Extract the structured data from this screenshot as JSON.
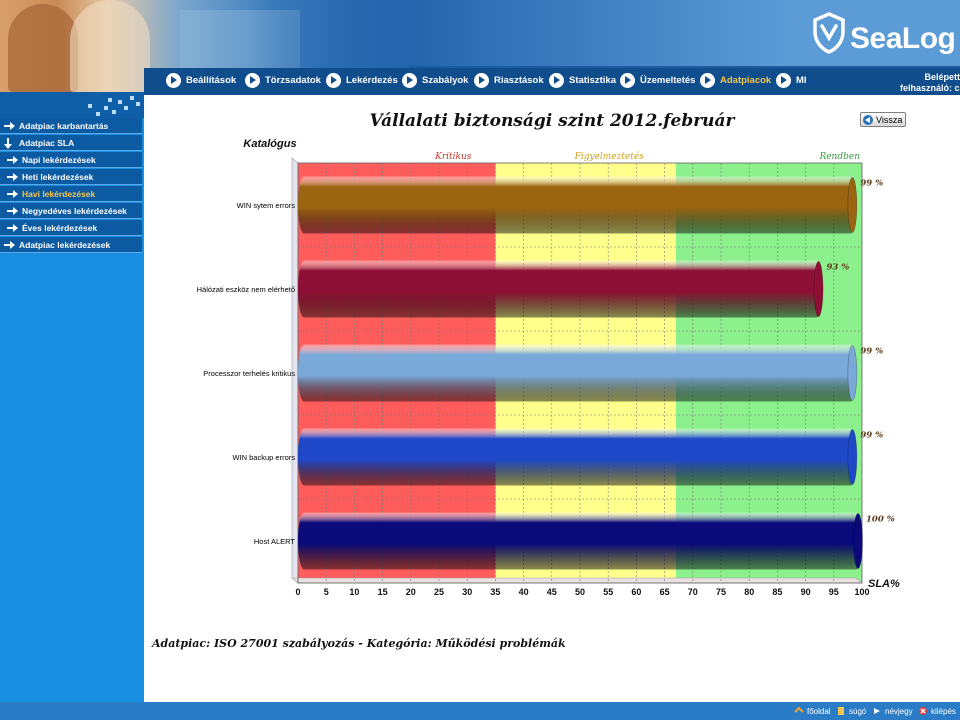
{
  "brand": {
    "logo_text": "SeaLog"
  },
  "nav": {
    "items": [
      {
        "label": "Beállítások"
      },
      {
        "label": "Törzsadatok"
      },
      {
        "label": "Lekérdezés"
      },
      {
        "label": "Szabályok"
      },
      {
        "label": "Riasztások"
      },
      {
        "label": "Statisztika"
      },
      {
        "label": "Üzemeltetés"
      },
      {
        "label": "Adatpiacok"
      },
      {
        "label": "MI"
      }
    ],
    "active_item": "Adatpiacok",
    "login_line1": "Belépett",
    "login_line2": "felhasználó: csizmar"
  },
  "sidebar": {
    "items": [
      {
        "label": "Adatpiac karbantartás"
      },
      {
        "label": "Adatpiac SLA"
      },
      {
        "label": "Napi lekérdezések"
      },
      {
        "label": "Heti lekérdezések"
      },
      {
        "label": "Havi lekérdezések"
      },
      {
        "label": "Negyedéves lekérdezések"
      },
      {
        "label": "Éves lekérdezések"
      },
      {
        "label": "Adatpiac lekérdezések"
      }
    ],
    "active_item": "Havi lekérdezések"
  },
  "main": {
    "back_label": "Vissza",
    "footer_caption": "Adatpiac: ISO 27001 szabályozás  -  Kategória: Működési problémák"
  },
  "chart_data": {
    "type": "bar",
    "orientation": "horizontal",
    "title": "Vállalati biztonsági szint 2012.február",
    "ylabel": "Katalógus",
    "xlabel": "SLA%",
    "xlim": [
      0,
      100
    ],
    "xticks": [
      "0",
      "5",
      "10",
      "15",
      "20",
      "25",
      "30",
      "35",
      "40",
      "45",
      "50",
      "55",
      "60",
      "65",
      "70",
      "75",
      "80",
      "85",
      "90",
      "95",
      "100"
    ],
    "zones": [
      {
        "label": "Kritikus",
        "from": 0,
        "to": 35,
        "color": "#ff5c5c",
        "label_color": "#c0392b"
      },
      {
        "label": "Figyelmeztetés",
        "from": 35,
        "to": 67,
        "color": "#ffff8c",
        "label_color": "#d4a017"
      },
      {
        "label": "Rendben",
        "from": 67,
        "to": 100,
        "color": "#8cf08c",
        "label_color": "#3a9a3a"
      }
    ],
    "grid": true,
    "categories": [
      "WIN sytem errors",
      "Hálózati eszköz nem elérhető",
      "Processzor terhelés kritikus",
      "WIN backup errors",
      "Host ALERT"
    ],
    "values": [
      99,
      93,
      99,
      99,
      100
    ],
    "value_labels": [
      "99 %",
      "93 %",
      "99 %",
      "99 %",
      "100 %"
    ],
    "bar_colors": [
      "#9a6410",
      "#8e0f35",
      "#7aa8d8",
      "#1f48c8",
      "#0a0a7a"
    ]
  },
  "bottombar": {
    "items": [
      {
        "label": "főoldal"
      },
      {
        "label": "súgó"
      },
      {
        "label": "névjegy"
      },
      {
        "label": "kilépés"
      }
    ]
  }
}
